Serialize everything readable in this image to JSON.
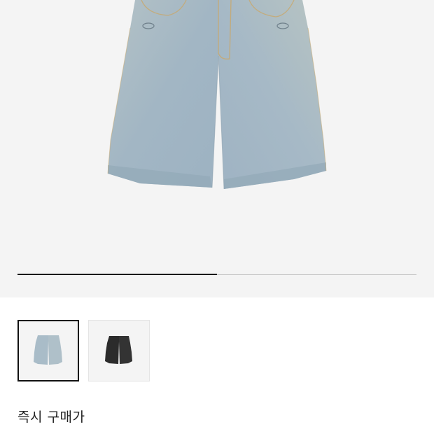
{
  "gallery": {
    "current_image_index": 1,
    "image_count": 2,
    "progress_fraction": 0.5,
    "colors": {
      "hero_background": "#f4f4f4",
      "progress_track": "#bdbdbd",
      "progress_fill": "#111111",
      "light_denim": "#a9bcc8",
      "dark_denim": "#2b2b2b"
    }
  },
  "thumbnails": [
    {
      "variant": "light-wash-denim-shorts",
      "selected": true
    },
    {
      "variant": "black-wash-denim-shorts",
      "selected": false
    }
  ],
  "purchase": {
    "instant_price_label": "즉시 구매가"
  }
}
